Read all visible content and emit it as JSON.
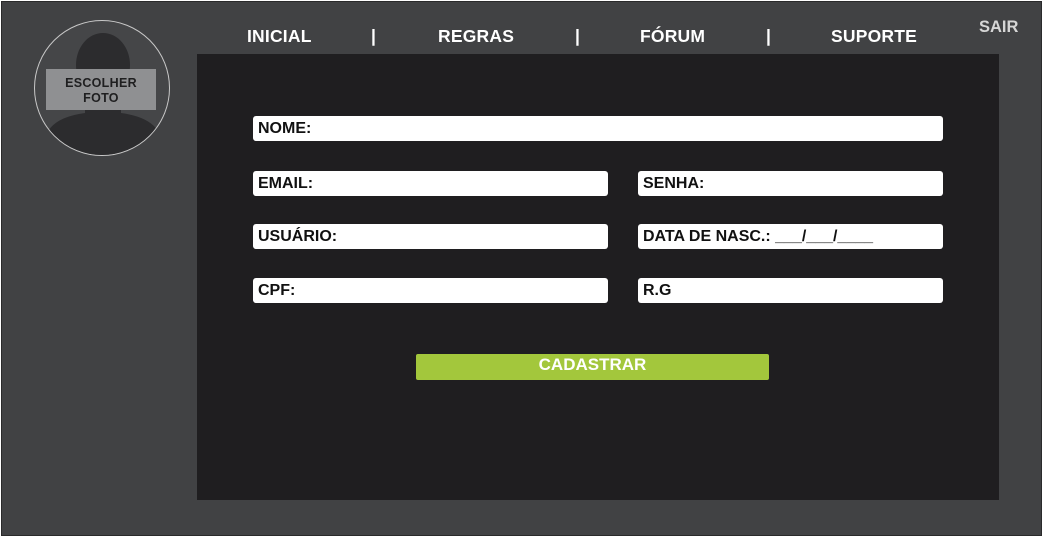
{
  "avatar": {
    "button_label": "ESCOLHER\nFOTO"
  },
  "nav": {
    "items": [
      {
        "label": "INICIAL"
      },
      {
        "label": "REGRAS"
      },
      {
        "label": "FÓRUM"
      },
      {
        "label": "SUPORTE"
      }
    ],
    "separator": "|",
    "logout_label": "SAIR"
  },
  "form": {
    "name_label": "NOME:",
    "email_label": "EMAIL:",
    "password_label": "SENHA:",
    "username_label": "USUÁRIO:",
    "birthdate_label": "DATA DE NASC.: ___/___/____",
    "cpf_label": "CPF:",
    "rg_label": "R.G",
    "submit_label": "CADASTRAR"
  },
  "colors": {
    "background": "#414244",
    "panel": "#1f1e20",
    "accent": "#a3c73c",
    "field": "#ffffff"
  },
  "icons": {
    "avatar": "user-silhouette-icon"
  }
}
